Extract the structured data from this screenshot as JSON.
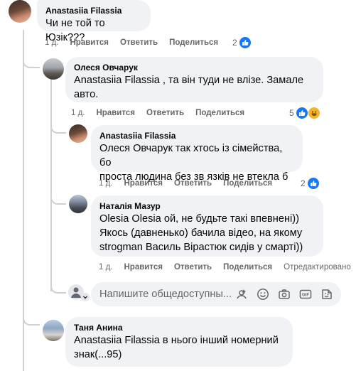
{
  "comments": [
    {
      "author": "Anastasiia Filassia",
      "text": "Чи не той то Юзік???",
      "time": "1 д.",
      "like_label": "Нравится",
      "reply_label": "Ответить",
      "share_label": "Поделиться",
      "reaction_count": "2"
    },
    {
      "author": "Олеся Овчарук",
      "text_line1": "Anastasiia Filassia , та він туди не влізе. Замале",
      "text_line2": "авто.",
      "time": "1 д.",
      "like_label": "Нравится",
      "reply_label": "Ответить",
      "share_label": "Поделиться",
      "reaction_count": "5"
    },
    {
      "author": "Anastasiia Filassia",
      "text_line1": "Олеся Овчарук так хтось із сімейства, бо",
      "text_line2": "проста людина без зв язків не втекла б",
      "time": "1 д.",
      "like_label": "Нравится",
      "reply_label": "Ответить",
      "share_label": "Поделиться",
      "reaction_count": "2"
    },
    {
      "author": "Наталія Мазур",
      "text_line1": "Olesia Olesia ой, не будьте такі впевнені))",
      "text_line2": "Якось (давненько) бачила відео, на якому",
      "text_line3": "strogman Василь Вірастюк сидів у смарті))",
      "time": "1 д.",
      "like_label": "Нравится",
      "reply_label": "Ответить",
      "share_label": "Поделиться",
      "edited_label": "Отредактировано"
    },
    {
      "author": "Таня Анина",
      "text_line1": "Anastasiia Filassia в нього інший номерний",
      "text_line2": "знак(...95)"
    }
  ],
  "composer": {
    "placeholder": "Напишите общедоступны..."
  },
  "icons": {
    "like": "like-icon",
    "haha": "haha-icon",
    "emoji": "emoji-icon",
    "camera": "camera-icon",
    "gif": "gif-icon",
    "sticker": "sticker-icon",
    "avatar_sticker": "avatar-sticker-icon"
  },
  "colors": {
    "bubble": "#f0f2f5",
    "like_blue": "#1877f2",
    "meta_gray": "#65676b"
  }
}
